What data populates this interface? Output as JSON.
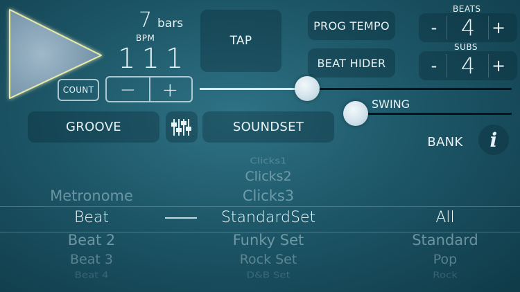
{
  "bars": {
    "value": "7",
    "label": "bars"
  },
  "bpm": {
    "label": "BPM",
    "value": "111"
  },
  "count": {
    "label": "COUNT"
  },
  "tempo_stepper": {
    "minus": "−",
    "plus": "+"
  },
  "tap": {
    "label": "TAP"
  },
  "prog_tempo": {
    "label": "PROG TEMPO"
  },
  "beat_hider": {
    "label": "BEAT HIDER"
  },
  "beats": {
    "label": "BEATS",
    "value": "4",
    "minus": "-",
    "plus": "+"
  },
  "subs": {
    "label": "SUBS",
    "value": "4",
    "minus": "-",
    "plus": "+"
  },
  "tempo_slider": {
    "fraction": 0.33
  },
  "swing": {
    "label": "SWING",
    "fraction": 0.0
  },
  "groove": {
    "label": "GROOVE"
  },
  "mixer": {
    "icon": "mixer-sliders-icon"
  },
  "soundset": {
    "label": "SOUNDSET"
  },
  "bank": {
    "label": "BANK"
  },
  "info": {
    "label": "i",
    "icon": "info-icon"
  },
  "picker": {
    "col1": {
      "above": [
        "Metronome"
      ],
      "selected": "Beat",
      "below": [
        "Beat 2",
        "Beat 3",
        "Beat 4"
      ]
    },
    "col2": {
      "above": [
        "Clicks1",
        "Clicks2",
        "Clicks3"
      ],
      "selected": "StandardSet",
      "below": [
        "Funky Set",
        "Rock Set",
        "D&B Set"
      ]
    },
    "col3": {
      "above": [],
      "selected": "All",
      "below": [
        "Standard",
        "Pop",
        "Rock"
      ]
    }
  },
  "colors": {
    "accent": "#d9e7ee",
    "background": "#1d5768",
    "slider_track_dark": "#0a1418"
  }
}
